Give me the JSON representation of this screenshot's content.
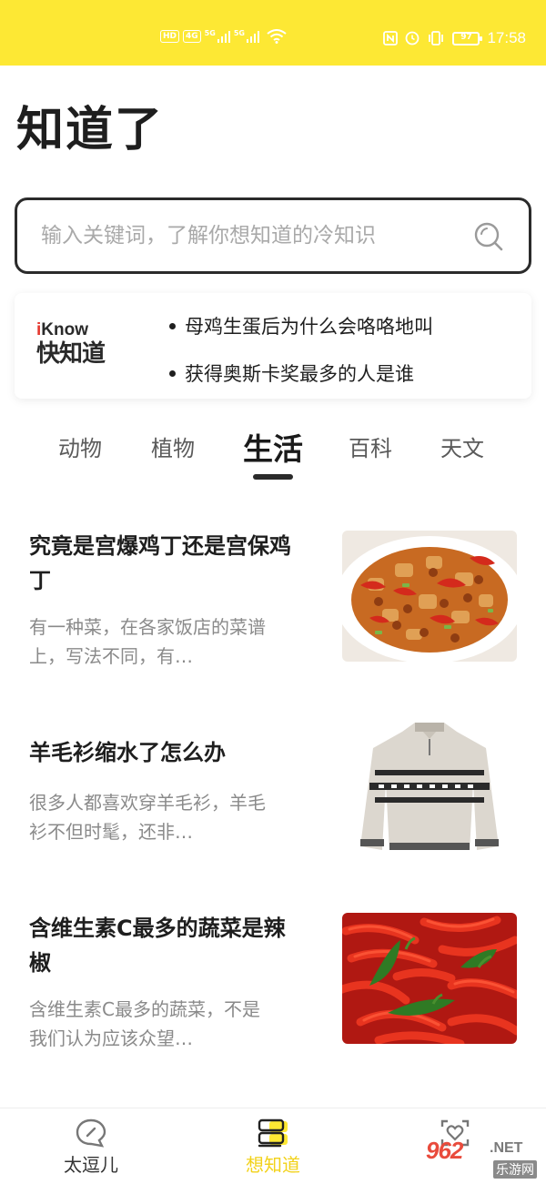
{
  "status_bar": {
    "time": "17:58",
    "battery": "97",
    "network_a": "HD",
    "network_b": "4G",
    "signal_label_1": "5G",
    "signal_label_2": "5G"
  },
  "page_title": "知道了",
  "search": {
    "placeholder": "输入关键词，了解你想知道的冷知识"
  },
  "banner": {
    "logo_en_i": "i",
    "logo_en_rest": "Know",
    "logo_cn": "快知道",
    "items": [
      "母鸡生蛋后为什么会咯咯地叫",
      "获得奥斯卡奖最多的人是谁"
    ]
  },
  "tabs": [
    {
      "label": "动物",
      "active": false
    },
    {
      "label": "植物",
      "active": false
    },
    {
      "label": "生活",
      "active": true
    },
    {
      "label": "百科",
      "active": false
    },
    {
      "label": "天文",
      "active": false
    }
  ],
  "articles": [
    {
      "title": "究竟是宫爆鸡丁还是宫保鸡丁",
      "desc": "有一种菜，在各家饭店的菜谱上，写法不同，有…",
      "image": "kung-pao-chicken-photo"
    },
    {
      "title": "羊毛衫缩水了怎么办",
      "desc": "很多人都喜欢穿羊毛衫，羊毛衫不但时髦，还非…",
      "image": "wool-sweater-photo"
    },
    {
      "title": "含维生素C最多的蔬菜是辣椒",
      "desc": "含维生素C最多的蔬菜，不是我们认为应该众望…",
      "image": "red-chili-peppers-photo"
    }
  ],
  "bottom_nav": [
    {
      "label": "太逗儿",
      "icon": "chat-bubble-icon",
      "active": false
    },
    {
      "label": "想知道",
      "icon": "books-icon",
      "active": true
    },
    {
      "label": "",
      "icon": "heart-frame-icon",
      "active": false
    }
  ],
  "watermark": {
    "brand": "962",
    "suffix": ".NET",
    "subtitle": "乐游网"
  },
  "colors": {
    "accent_yellow": "#fde834",
    "nav_active": "#f2d21a",
    "title_dark": "#1e1e1e",
    "desc_gray": "#8a8a8a"
  }
}
